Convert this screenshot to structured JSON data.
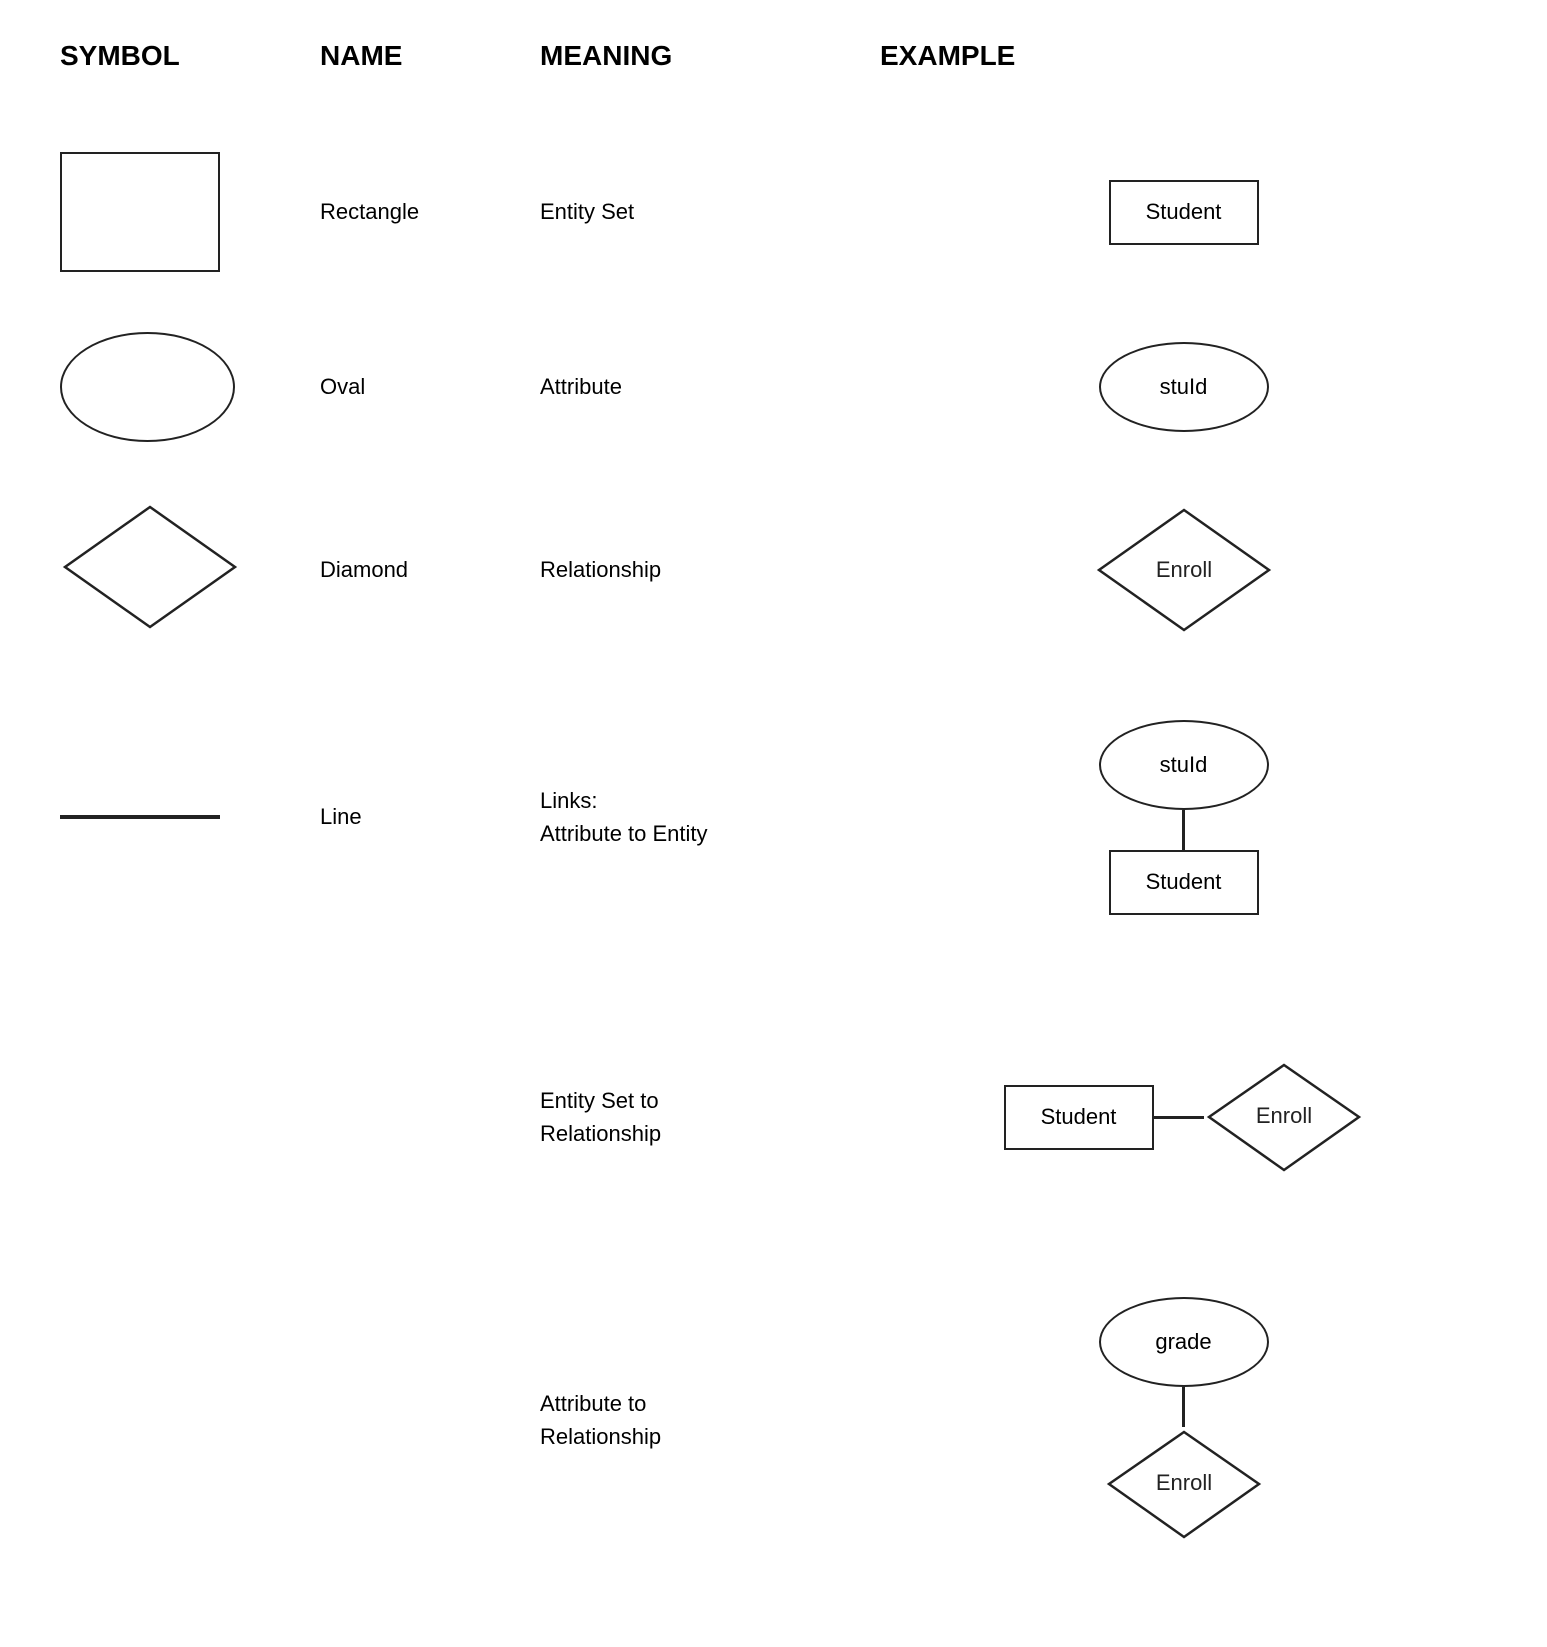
{
  "header": {
    "col1": "SYMBOL",
    "col2": "NAME",
    "col3": "MEANING",
    "col4": "EXAMPLE"
  },
  "rows": [
    {
      "id": "rectangle",
      "name": "Rectangle",
      "meaning": "Entity Set",
      "example_label": "Student"
    },
    {
      "id": "oval",
      "name": "Oval",
      "meaning": "Attribute",
      "example_label": "stuId"
    },
    {
      "id": "diamond",
      "name": "Diamond",
      "meaning": "Relationship",
      "example_label": "Enroll"
    },
    {
      "id": "line",
      "name": "Line",
      "meaning_line1": "Links:",
      "meaning_line2": "Attribute to Entity",
      "example_oval": "stuId",
      "example_rect": "Student"
    }
  ],
  "complex_rows": [
    {
      "id": "entity-set-to-rel",
      "meaning_line1": "Entity Set to",
      "meaning_line2": "Relationship",
      "example_rect": "Student",
      "example_diamond": "Enroll"
    },
    {
      "id": "attr-to-rel",
      "meaning_line1": "Attribute to",
      "meaning_line2": "Relationship",
      "example_oval": "grade",
      "example_diamond": "Enroll"
    }
  ]
}
